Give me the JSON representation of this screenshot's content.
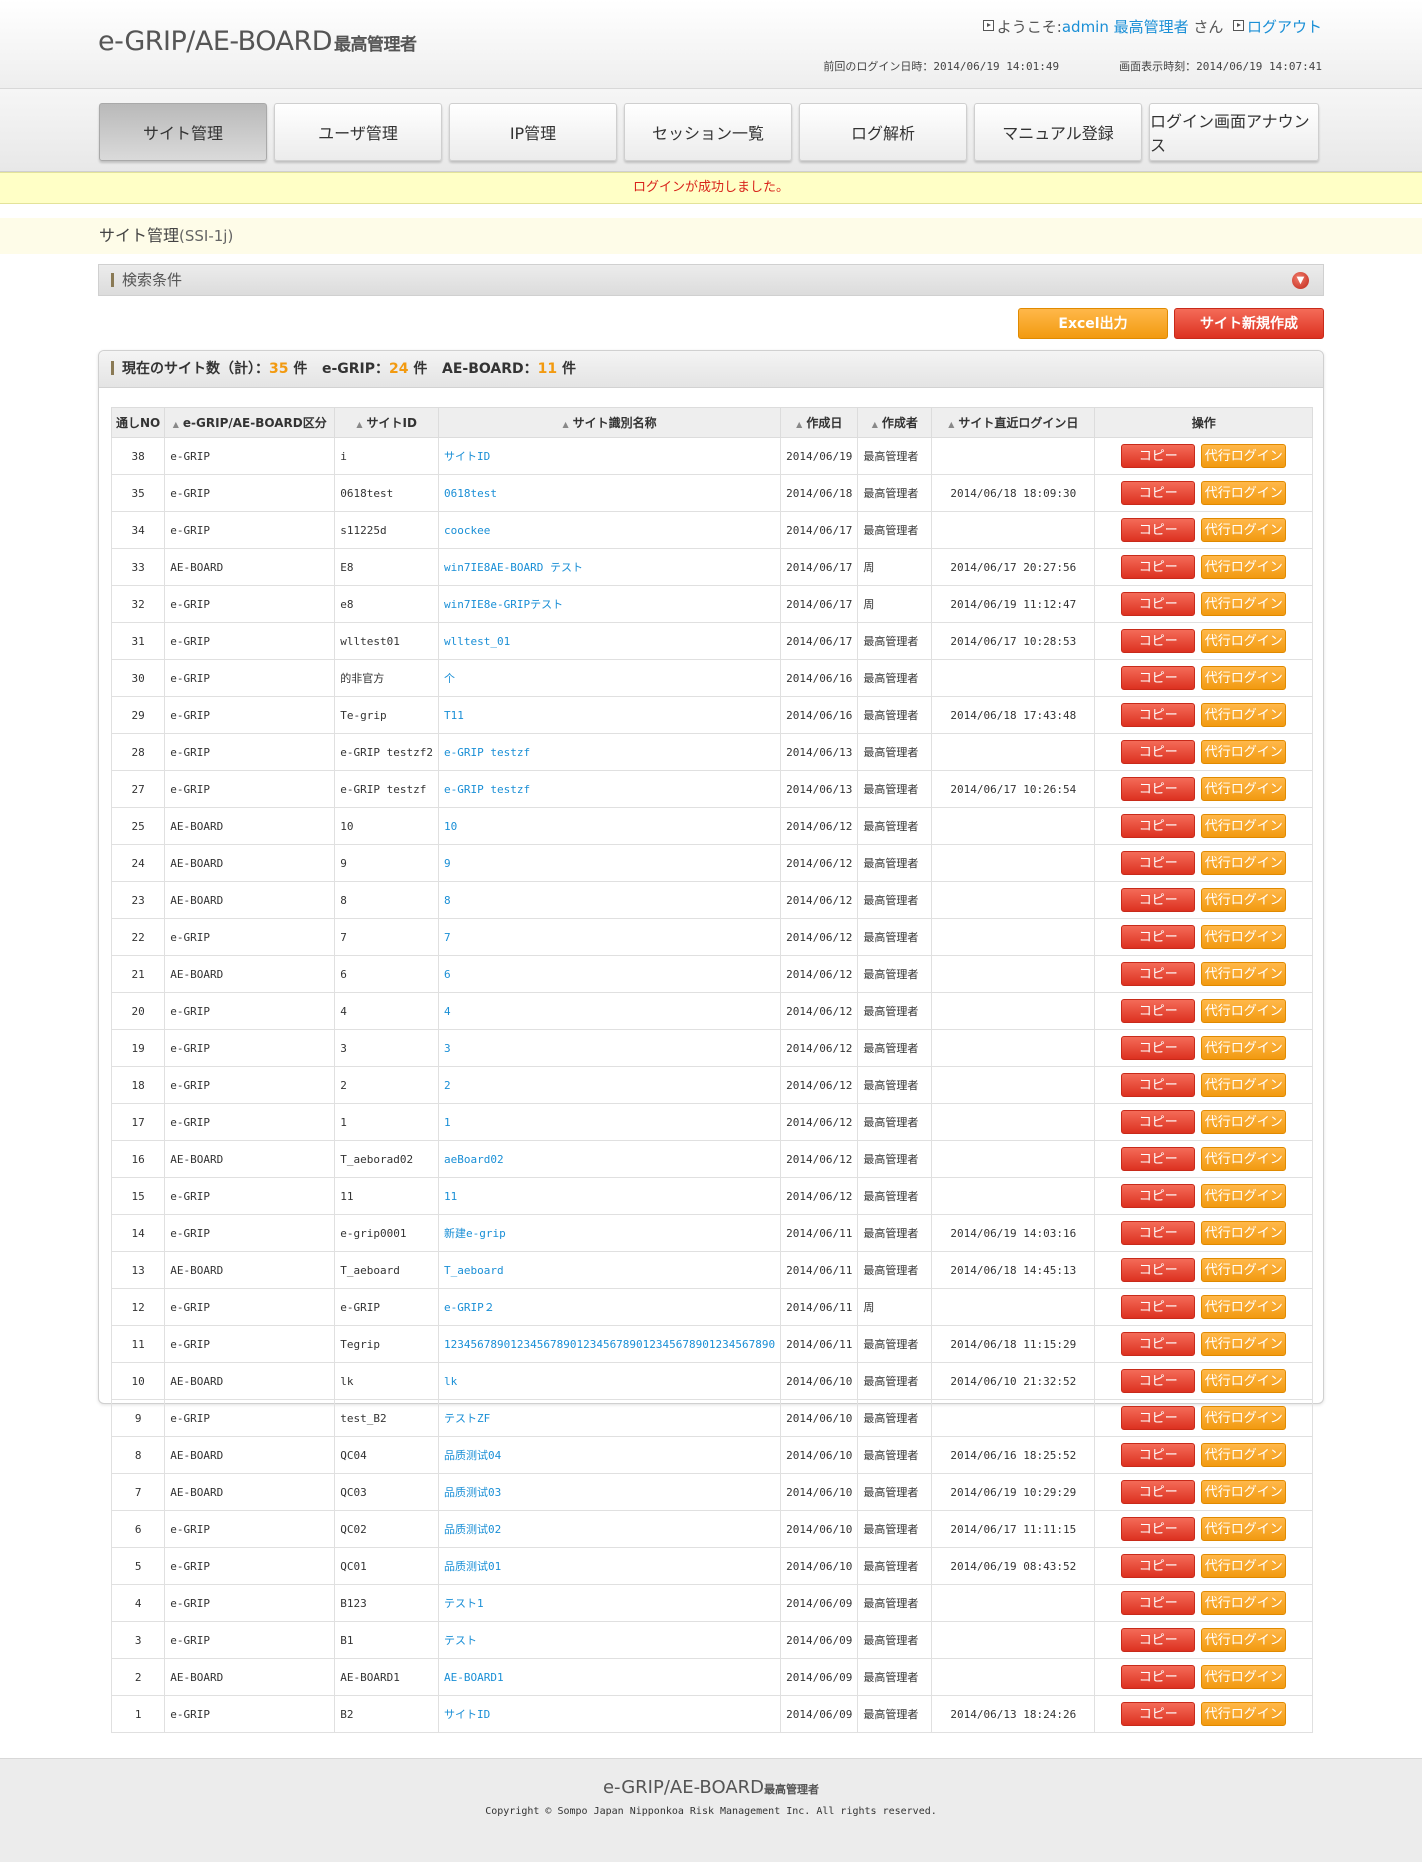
{
  "header": {
    "logo_main": "e-GRIP/AE-BOARD",
    "logo_sub": "最高管理者",
    "welcome_prefix": "ようこそ:",
    "user_name": "admin 最高管理者",
    "welcome_suffix": "さん",
    "logout": "ログアウト",
    "last_login": "前回のログイン日時：2014/06/19 14:01:49",
    "display_time": "画面表示時刻：2014/06/19 14:07:41"
  },
  "nav": {
    "tabs": [
      "サイト管理",
      "ユーザ管理",
      "IP管理",
      "セッション一覧",
      "ログ解析",
      "マニュアル登録",
      "ログイン画面アナウンス"
    ]
  },
  "message": "ログインが成功しました。",
  "page": {
    "title": "サイト管理",
    "code": "(SSI-1j)"
  },
  "search": {
    "label": "検索条件"
  },
  "actions": {
    "excel": "Excel出力",
    "new_site": "サイト新規作成"
  },
  "summary": {
    "total_label": "現在のサイト数（計）：",
    "total": "35",
    "unit": "件",
    "egrip_label": "e-GRIP：",
    "egrip": "24",
    "ae_label": "AE-BOARD：",
    "ae": "11"
  },
  "table": {
    "headers": [
      "通しNO",
      "e-GRIP/AE-BOARD区分",
      "サイトID",
      "サイト識別名称",
      "作成日",
      "作成者",
      "サイト直近ログイン日",
      "操作"
    ],
    "copy_label": "コピー",
    "proxy_label": "代行ログイン",
    "rows": [
      [
        "38",
        "e-GRIP",
        "i",
        "サイトID",
        "2014/06/19",
        "最高管理者",
        ""
      ],
      [
        "35",
        "e-GRIP",
        "0618test",
        "0618test",
        "2014/06/18",
        "最高管理者",
        "2014/06/18 18:09:30"
      ],
      [
        "34",
        "e-GRIP",
        "s11225d",
        "coockee",
        "2014/06/17",
        "最高管理者",
        ""
      ],
      [
        "33",
        "AE-BOARD",
        "E8",
        "win7IE8AE-BOARD テスト",
        "2014/06/17",
        "周",
        "2014/06/17 20:27:56"
      ],
      [
        "32",
        "e-GRIP",
        "e8",
        "win7IE8e-GRIPテスト",
        "2014/06/17",
        "周",
        "2014/06/19 11:12:47"
      ],
      [
        "31",
        "e-GRIP",
        "wlltest01",
        "wlltest_01",
        "2014/06/17",
        "最高管理者",
        "2014/06/17 10:28:53"
      ],
      [
        "30",
        "e-GRIP",
        "的非官方",
        "个",
        "2014/06/16",
        "最高管理者",
        ""
      ],
      [
        "29",
        "e-GRIP",
        "Te-grip",
        "T11",
        "2014/06/16",
        "最高管理者",
        "2014/06/18 17:43:48"
      ],
      [
        "28",
        "e-GRIP",
        "e-GRIP testzf2",
        "e-GRIP testzf",
        "2014/06/13",
        "最高管理者",
        ""
      ],
      [
        "27",
        "e-GRIP",
        "e-GRIP testzf",
        "e-GRIP testzf",
        "2014/06/13",
        "最高管理者",
        "2014/06/17 10:26:54"
      ],
      [
        "25",
        "AE-BOARD",
        "10",
        "10",
        "2014/06/12",
        "最高管理者",
        ""
      ],
      [
        "24",
        "AE-BOARD",
        "9",
        "9",
        "2014/06/12",
        "最高管理者",
        ""
      ],
      [
        "23",
        "AE-BOARD",
        "8",
        "8",
        "2014/06/12",
        "最高管理者",
        ""
      ],
      [
        "22",
        "e-GRIP",
        "7",
        "7",
        "2014/06/12",
        "最高管理者",
        ""
      ],
      [
        "21",
        "AE-BOARD",
        "6",
        "6",
        "2014/06/12",
        "最高管理者",
        ""
      ],
      [
        "20",
        "e-GRIP",
        "4",
        "4",
        "2014/06/12",
        "最高管理者",
        ""
      ],
      [
        "19",
        "e-GRIP",
        "3",
        "3",
        "2014/06/12",
        "最高管理者",
        ""
      ],
      [
        "18",
        "e-GRIP",
        "2",
        "2",
        "2014/06/12",
        "最高管理者",
        ""
      ],
      [
        "17",
        "e-GRIP",
        "1",
        "1",
        "2014/06/12",
        "最高管理者",
        ""
      ],
      [
        "16",
        "AE-BOARD",
        "T_aeborad02",
        "aeBoard02",
        "2014/06/12",
        "最高管理者",
        ""
      ],
      [
        "15",
        "e-GRIP",
        "11",
        "11",
        "2014/06/12",
        "最高管理者",
        ""
      ],
      [
        "14",
        "e-GRIP",
        "e-grip0001",
        "新建e-grip",
        "2014/06/11",
        "最高管理者",
        "2014/06/19 14:03:16"
      ],
      [
        "13",
        "AE-BOARD",
        "T_aeboard",
        "T_aeboard",
        "2014/06/11",
        "最高管理者",
        "2014/06/18 14:45:13"
      ],
      [
        "12",
        "e-GRIP",
        "e-GRIP",
        "e-GRIP２",
        "2014/06/11",
        "周",
        ""
      ],
      [
        "11",
        "e-GRIP",
        "Tegrip",
        "12345678901234567890123456789012345678901234567890",
        "2014/06/11",
        "最高管理者",
        "2014/06/18 11:15:29"
      ],
      [
        "10",
        "AE-BOARD",
        "lk",
        "lk",
        "2014/06/10",
        "最高管理者",
        "2014/06/10 21:32:52"
      ],
      [
        "9",
        "e-GRIP",
        "test_B2",
        "テストZF",
        "2014/06/10",
        "最高管理者",
        ""
      ],
      [
        "8",
        "AE-BOARD",
        "QC04",
        "品质测试04",
        "2014/06/10",
        "最高管理者",
        "2014/06/16 18:25:52"
      ],
      [
        "7",
        "AE-BOARD",
        "QC03",
        "品质测试03",
        "2014/06/10",
        "最高管理者",
        "2014/06/19 10:29:29"
      ],
      [
        "6",
        "e-GRIP",
        "QC02",
        "品质测试02",
        "2014/06/10",
        "最高管理者",
        "2014/06/17 11:11:15"
      ],
      [
        "5",
        "e-GRIP",
        "QC01",
        "品质测试01",
        "2014/06/10",
        "最高管理者",
        "2014/06/19 08:43:52"
      ],
      [
        "4",
        "e-GRIP",
        "B123",
        "テスト1",
        "2014/06/09",
        "最高管理者",
        ""
      ],
      [
        "3",
        "e-GRIP",
        "B1",
        "テスト",
        "2014/06/09",
        "最高管理者",
        ""
      ],
      [
        "2",
        "AE-BOARD",
        "AE-BOARD1",
        "AE-BOARD1",
        "2014/06/09",
        "最高管理者",
        ""
      ],
      [
        "1",
        "e-GRIP",
        "B2",
        "サイトID",
        "2014/06/09",
        "最高管理者",
        "2014/06/13 18:24:26"
      ]
    ]
  },
  "footer": {
    "logo_main": "e-GRIP/AE-BOARD",
    "logo_sub": "最高管理者",
    "copyright": "Copyright © Sompo Japan Nipponkoa Risk Management Inc. All rights reserved."
  }
}
